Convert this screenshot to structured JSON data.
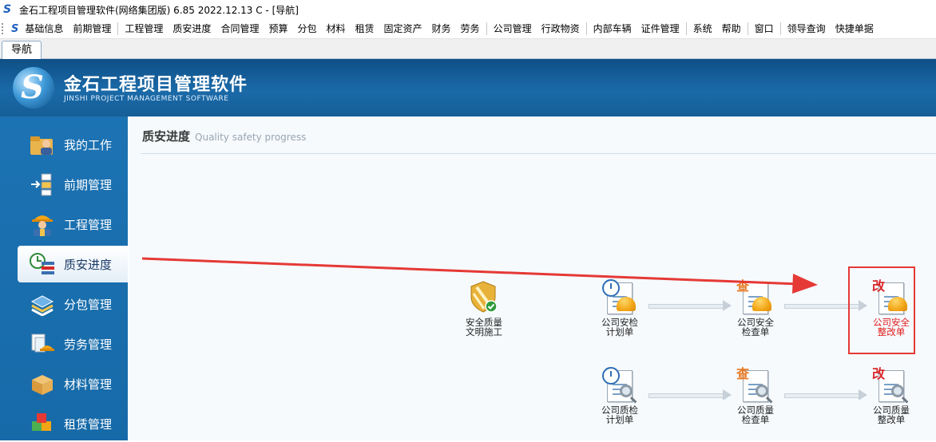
{
  "window": {
    "title": "金石工程项目管理软件(网络集团版) 6.85  2022.12.13 C - [导航]"
  },
  "menubar": {
    "items": [
      "基础信息",
      "前期管理",
      "工程管理",
      "质安进度",
      "合同管理",
      "预算",
      "分包",
      "材料",
      "租赁",
      "固定资产",
      "财务",
      "劳务",
      "公司管理",
      "行政物资",
      "内部车辆",
      "证件管理",
      "系统",
      "帮助",
      "窗口",
      "领导查询",
      "快捷单据"
    ]
  },
  "tabs": [
    {
      "label": "导航"
    }
  ],
  "header": {
    "brand_cn": "金石工程项目管理软件",
    "brand_en": "JINSHI PROJECT MANAGEMENT SOFTWARE"
  },
  "sidebar": {
    "items": [
      {
        "label": "我的工作",
        "icon": "folder-user-icon"
      },
      {
        "label": "前期管理",
        "icon": "flowchart-icon"
      },
      {
        "label": "工程管理",
        "icon": "worker-icon"
      },
      {
        "label": "质安进度",
        "icon": "clock-list-icon"
      },
      {
        "label": "分包管理",
        "icon": "stack-icon"
      },
      {
        "label": "劳务管理",
        "icon": "labor-icon"
      },
      {
        "label": "材料管理",
        "icon": "box-icon"
      },
      {
        "label": "租赁管理",
        "icon": "cubes-icon"
      }
    ],
    "active": "质安进度"
  },
  "content": {
    "title": "质安进度",
    "title_en": "Quality safety progress",
    "nodes": {
      "civil": {
        "line1": "安全质量",
        "line2": "文明施工"
      },
      "safety_plan": {
        "line1": "公司安检",
        "line2": "计划单"
      },
      "safety_check": {
        "line1": "公司安全",
        "line2": "检查单"
      },
      "safety_rectify": {
        "line1": "公司安全",
        "line2": "整改单"
      },
      "quality_plan": {
        "line1": "公司质检",
        "line2": "计划单"
      },
      "quality_check": {
        "line1": "公司质量",
        "line2": "检查单"
      },
      "quality_rectify": {
        "line1": "公司质量",
        "line2": "整改单"
      }
    },
    "badges": {
      "check": "查",
      "rectify": "改"
    }
  },
  "colors": {
    "sidebar": "#1c73b3",
    "header": "#1a6aa8",
    "highlight": "#e53935",
    "annotation_arrow": "#e53935"
  }
}
